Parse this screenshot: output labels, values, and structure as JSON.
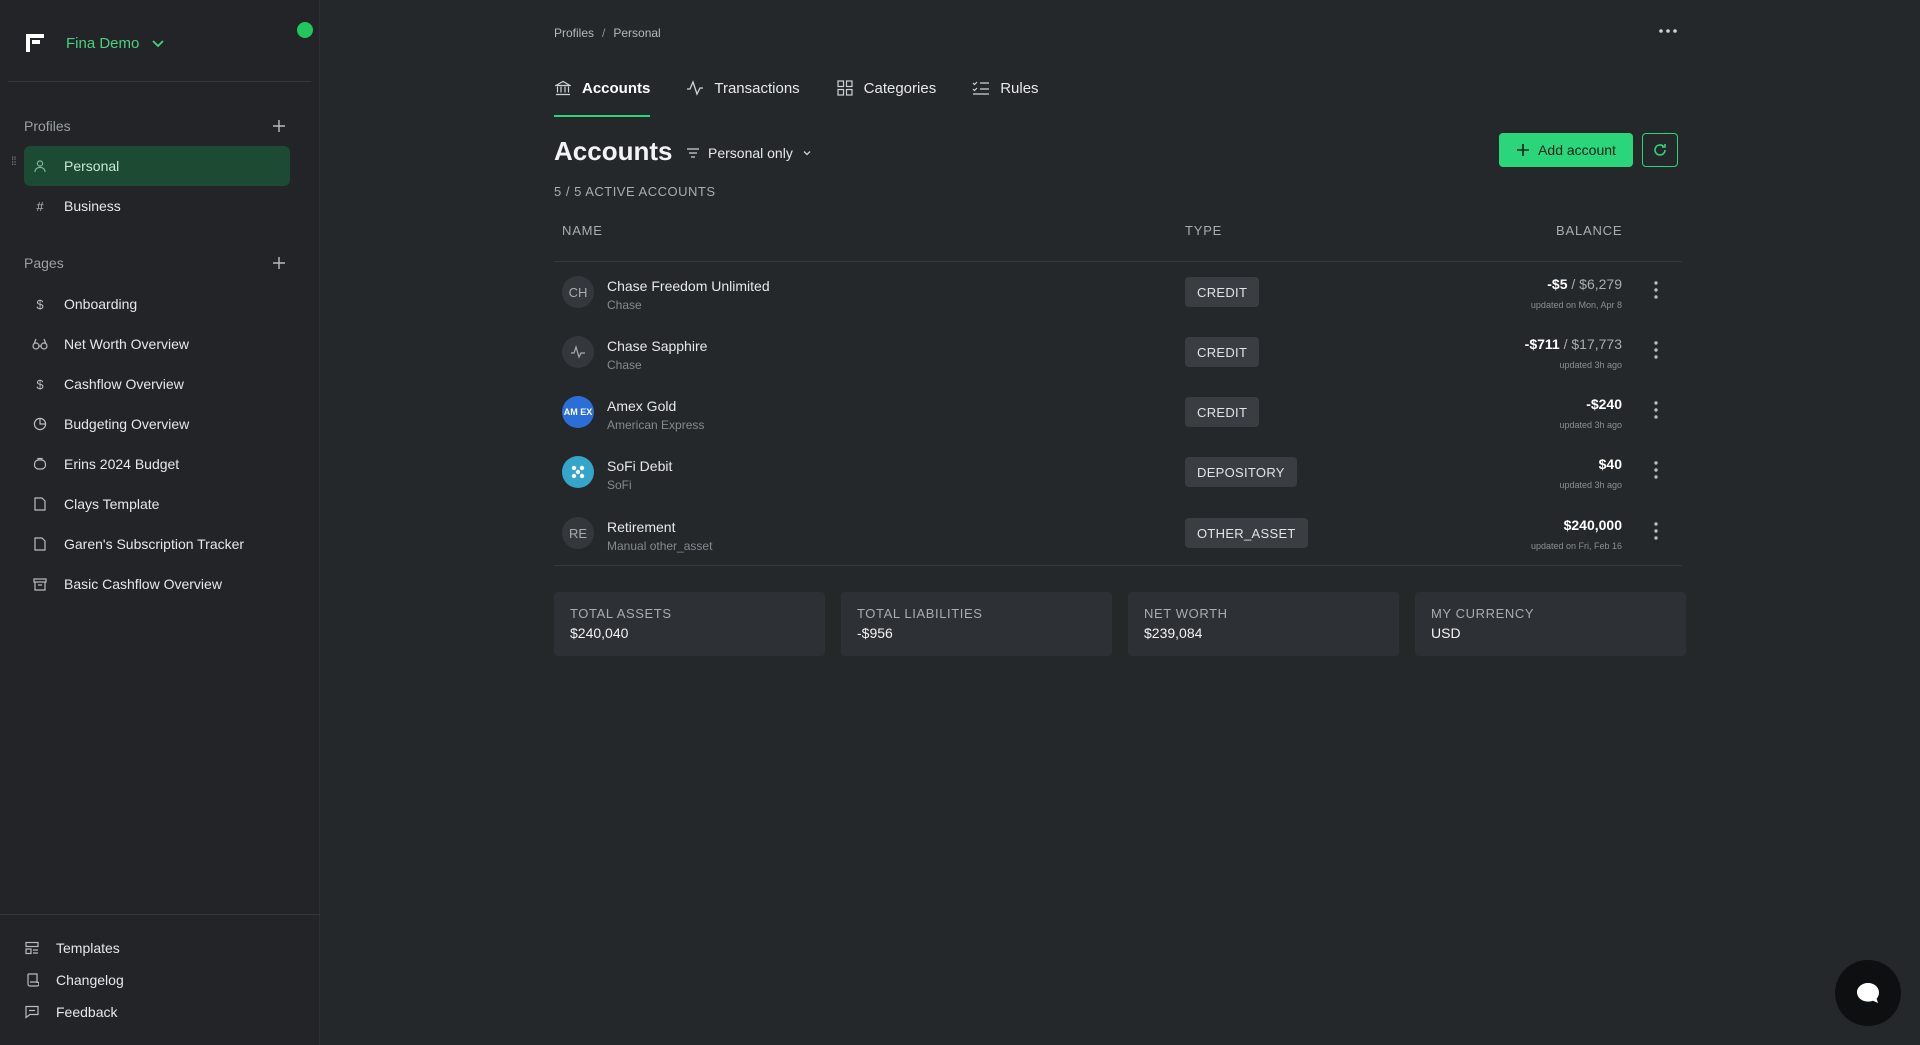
{
  "workspace": {
    "name": "Fina Demo"
  },
  "sidebar": {
    "profiles_header": "Profiles",
    "profiles": [
      {
        "label": "Personal",
        "icon": "user-icon"
      },
      {
        "label": "Business",
        "icon": "hash-icon"
      }
    ],
    "pages_header": "Pages",
    "pages": [
      {
        "label": "Onboarding",
        "icon": "dollar-icon"
      },
      {
        "label": "Net Worth Overview",
        "icon": "glasses-icon"
      },
      {
        "label": "Cashflow Overview",
        "icon": "dollar-icon"
      },
      {
        "label": "Budgeting Overview",
        "icon": "pie-icon"
      },
      {
        "label": "Erins 2024 Budget",
        "icon": "piggy-icon"
      },
      {
        "label": "Clays Template",
        "icon": "file-icon"
      },
      {
        "label": "Garen's Subscription Tracker",
        "icon": "file-icon"
      },
      {
        "label": "Basic Cashflow Overview",
        "icon": "archive-icon"
      }
    ],
    "footer": [
      {
        "label": "Templates",
        "icon": "layout-icon"
      },
      {
        "label": "Changelog",
        "icon": "scroll-icon"
      },
      {
        "label": "Feedback",
        "icon": "message-icon"
      }
    ]
  },
  "breadcrumb": {
    "parent": "Profiles",
    "separator": "/",
    "current": "Personal"
  },
  "tabs": [
    {
      "label": "Accounts",
      "icon": "bank-icon",
      "active": true
    },
    {
      "label": "Transactions",
      "icon": "activity-icon",
      "active": false
    },
    {
      "label": "Categories",
      "icon": "grid-icon",
      "active": false
    },
    {
      "label": "Rules",
      "icon": "list-check-icon",
      "active": false
    }
  ],
  "main": {
    "title": "Accounts",
    "filter_label": "Personal only",
    "add_button": "Add account",
    "active_count": "5 / 5 ACTIVE ACCOUNTS",
    "columns": {
      "name": "NAME",
      "type": "TYPE",
      "balance": "BALANCE"
    }
  },
  "accounts": [
    {
      "avatar": "CH",
      "avatar_style": "initials",
      "name": "Chase Freedom Unlimited",
      "institution": "Chase",
      "type": "CREDIT",
      "balance": "-$5",
      "limit": "$6,279",
      "updated": "updated on Mon, Apr 8"
    },
    {
      "avatar": "",
      "avatar_style": "activity",
      "name": "Chase Sapphire",
      "institution": "Chase",
      "type": "CREDIT",
      "balance": "-$711",
      "limit": "$17,773",
      "updated": "updated 3h ago"
    },
    {
      "avatar": "AM EX",
      "avatar_style": "amex",
      "name": "Amex Gold",
      "institution": "American Express",
      "type": "CREDIT",
      "balance": "-$240",
      "limit": "",
      "updated": "updated 3h ago"
    },
    {
      "avatar": "",
      "avatar_style": "sofi",
      "name": "SoFi Debit",
      "institution": "SoFi",
      "type": "DEPOSITORY",
      "balance": "$40",
      "limit": "",
      "updated": "updated 3h ago"
    },
    {
      "avatar": "RE",
      "avatar_style": "initials",
      "name": "Retirement",
      "institution": "Manual other_asset",
      "type": "OTHER_ASSET",
      "balance": "$240,000",
      "limit": "",
      "updated": "updated on Fri, Feb 16"
    }
  ],
  "summary": [
    {
      "label": "TOTAL ASSETS",
      "value": "$240,040"
    },
    {
      "label": "TOTAL LIABILITIES",
      "value": "-$956"
    },
    {
      "label": "NET WORTH",
      "value": "$239,084"
    },
    {
      "label": "MY CURRENCY",
      "value": "USD"
    }
  ],
  "colors": {
    "accent": "#2bd67b",
    "status": "#22c55e",
    "active_nav": "#1c4a33",
    "background": "#25282b"
  }
}
